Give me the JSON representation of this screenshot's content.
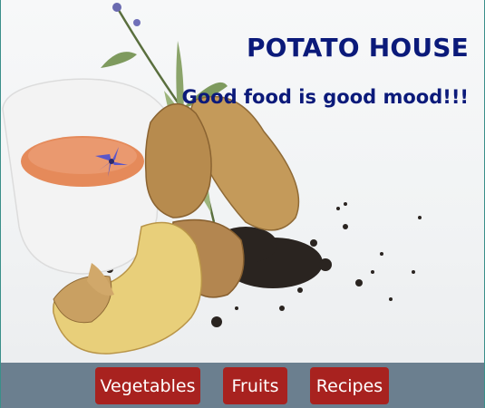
{
  "header": {
    "title": "POTATO HOUSE",
    "tagline": "Good food is good mood!!!"
  },
  "hero_image": {
    "subject": "potatoes-with-tea-cup-and-sage"
  },
  "nav": {
    "items": [
      {
        "label": "Vegetables"
      },
      {
        "label": "Fruits"
      },
      {
        "label": "Recipes"
      }
    ]
  },
  "colors": {
    "title": "#0b1a7a",
    "nav_background": "#6b7f8f",
    "button_background": "#a8221f",
    "button_text": "#ffffff",
    "frame_border": "#3a8f8a"
  }
}
